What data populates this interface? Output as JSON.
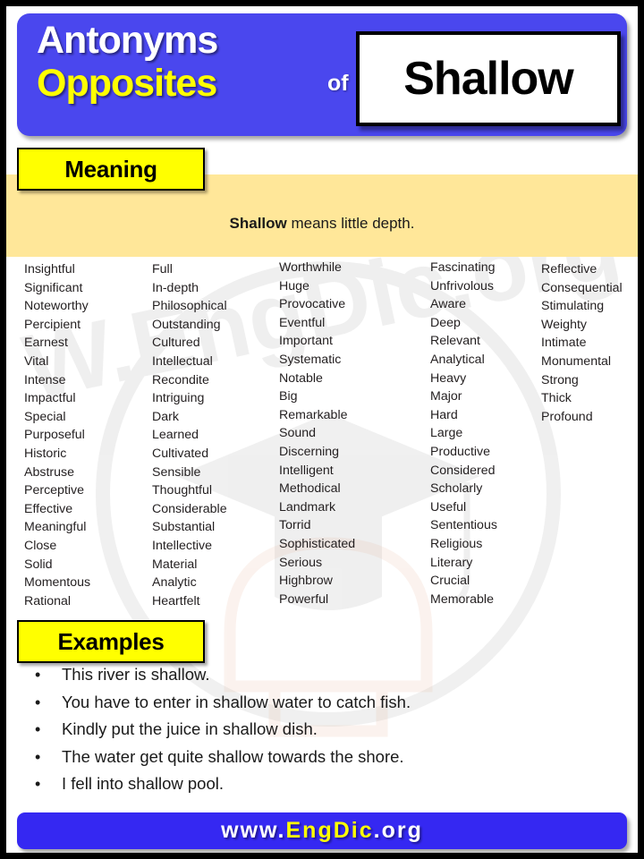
{
  "header": {
    "line1": "Antonyms",
    "line2": "Opposites",
    "of": "of",
    "word": "Shallow",
    "band_color": "#4a47ee",
    "line1_color": "#ffffff",
    "line2_color": "#ffff00"
  },
  "meaning": {
    "tag": "Meaning",
    "term": "Shallow",
    "text": " means little depth.",
    "band_color": "#ffe799",
    "tag_color": "#ffff00"
  },
  "words": {
    "columns": [
      {
        "items": [
          "Insightful",
          "Significant",
          "Noteworthy",
          "Percipient",
          "Earnest",
          "Vital",
          "Intense",
          "Impactful",
          "Special",
          "Purposeful",
          "Historic",
          "Abstruse",
          "Perceptive",
          "Effective",
          "Meaningful",
          "Close",
          "Solid",
          "Momentous",
          "Rational"
        ]
      },
      {
        "items": [
          "Full",
          "In-depth",
          "Philosophical",
          "Outstanding",
          "Cultured",
          "Intellectual",
          "Recondite",
          "Intriguing",
          "Dark",
          "Learned",
          "Cultivated",
          "Sensible",
          "Thoughtful",
          "Considerable",
          "Substantial",
          "Intellective",
          "Material",
          "Analytic",
          "Heartfelt"
        ]
      },
      {
        "items": [
          "Worthwhile",
          "Huge",
          "Provocative",
          "Eventful",
          "Important",
          "Systematic",
          "Notable",
          "Big",
          "Remarkable",
          "Sound",
          "Discerning",
          "Intelligent",
          "Methodical",
          "Landmark",
          "Torrid",
          "Sophisticated",
          "Serious",
          "Highbrow",
          "Powerful"
        ]
      },
      {
        "items": [
          "Fascinating",
          "Unfrivolous",
          "Aware",
          "Deep",
          "Relevant",
          "Analytical",
          "Heavy",
          "Major",
          "Hard",
          "Large",
          "Productive",
          "Considered",
          "Scholarly",
          "Useful",
          "Sententious",
          "Religious",
          "Literary",
          "Crucial",
          "Memorable"
        ]
      },
      {
        "items": [
          "Reflective",
          "Consequential",
          "Stimulating",
          "Weighty",
          "Intimate",
          "Monumental",
          "Strong",
          "Thick",
          "Profound"
        ]
      }
    ]
  },
  "examples": {
    "tag": "Examples",
    "bullet": "•",
    "items": [
      "This river is shallow.",
      "You have to enter in shallow water to catch fish.",
      "Kindly put the juice in shallow dish.",
      "The water get quite shallow towards the shore.",
      "I fell into shallow pool."
    ]
  },
  "footer": {
    "prefix": "www.",
    "brand": "EngDic",
    "suffix": ".org",
    "band_color": "#3528f2",
    "brand_color": "#ffff00"
  }
}
